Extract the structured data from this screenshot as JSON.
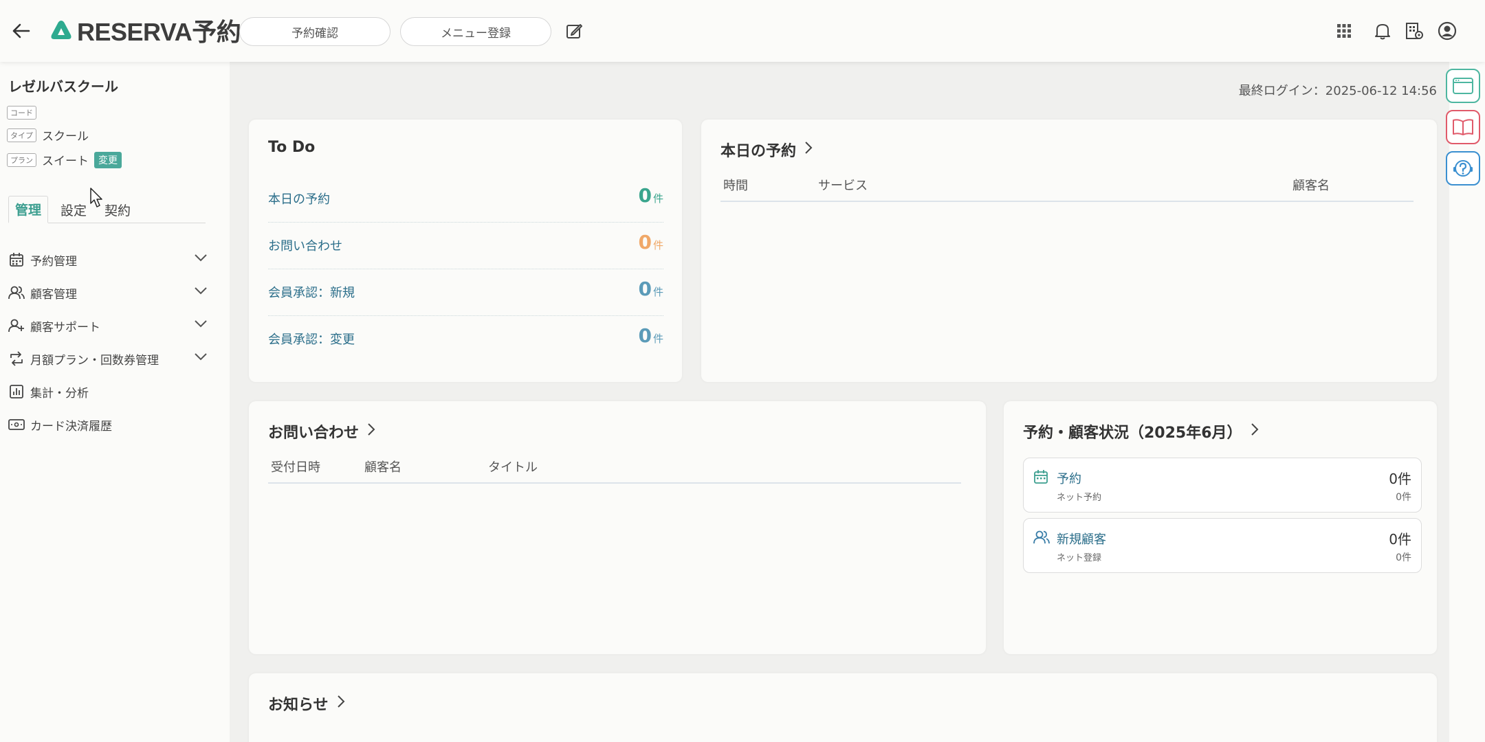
{
  "header": {
    "logo_text": "RESERVA予約",
    "btn_reservation_check": "予約確認",
    "btn_menu_register": "メニュー登録"
  },
  "sidebar": {
    "school_name": "レゼルバスクール",
    "code_tag": "コード",
    "type_tag": "タイプ",
    "type_value": "スクール",
    "plan_tag": "プラン",
    "plan_value": "スイート",
    "change_badge": "変更",
    "tabs": [
      "管理",
      "設定",
      "契約"
    ],
    "nav": [
      {
        "label": "予約管理",
        "icon": "calendar-icon"
      },
      {
        "label": "顧客管理",
        "icon": "users-icon"
      },
      {
        "label": "顧客サポート",
        "icon": "user-plus-icon"
      },
      {
        "label": "月額プラン・回数券管理",
        "icon": "repeat-icon"
      },
      {
        "label": "集計・分析",
        "icon": "bar-chart-icon"
      },
      {
        "label": "カード決済履歴",
        "icon": "card-icon"
      }
    ]
  },
  "main": {
    "last_login": "最終ログイン：2025-06-12 14:56",
    "todo": {
      "title": "To Do",
      "unit": "件",
      "rows": [
        {
          "label": "本日の予約",
          "count": "0"
        },
        {
          "label": "お問い合わせ",
          "count": "0"
        },
        {
          "label": "会員承認：新規",
          "count": "0"
        },
        {
          "label": "会員承認：変更",
          "count": "0"
        }
      ]
    },
    "today_reservations": {
      "title": "本日の予約",
      "columns": [
        "時間",
        "サービス",
        "顧客名"
      ]
    },
    "inquiries": {
      "title": "お問い合わせ",
      "columns": [
        "受付日時",
        "顧客名",
        "タイトル"
      ]
    },
    "status": {
      "title": "予約・顧客状況（2025年6月）",
      "items": [
        {
          "title": "予約",
          "sub": "ネット予約",
          "count": "0件",
          "sub_count": "0件"
        },
        {
          "title": "新規顧客",
          "sub": "ネット登録",
          "count": "0件",
          "sub_count": "0件"
        }
      ]
    },
    "news": {
      "title": "お知らせ"
    }
  },
  "colors": {
    "accent": "#3b9e8f",
    "todo_green": "#3aa58d",
    "todo_orange": "#f0a868",
    "todo_blue": "#5b9bb8",
    "float_green": "#4db6a0",
    "float_red": "#e05a6a",
    "float_blue": "#3a8fd0"
  }
}
